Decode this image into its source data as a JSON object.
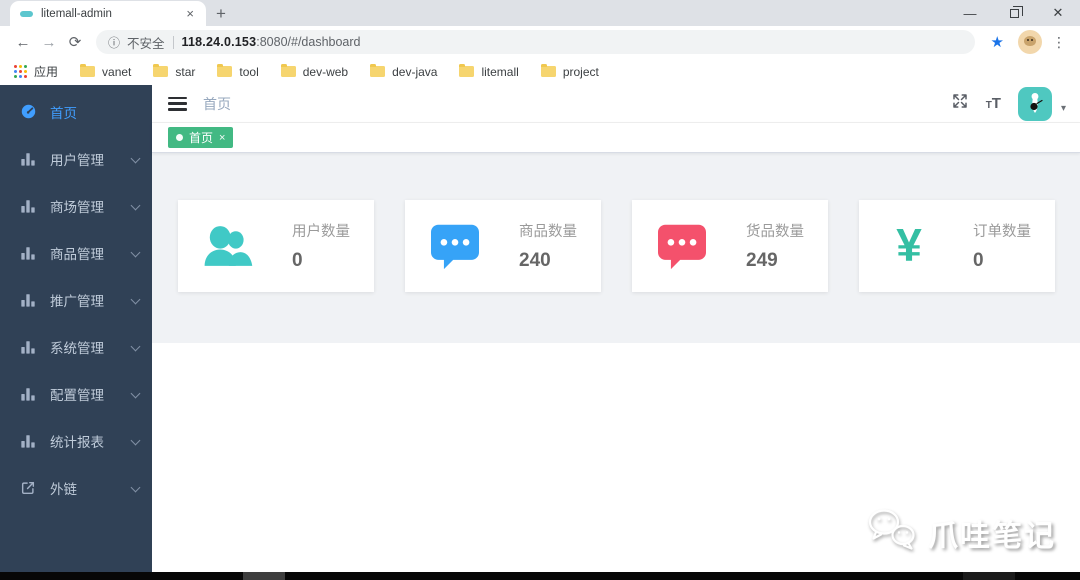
{
  "icons": {
    "back": "←",
    "forward": "→",
    "reload": "⟳",
    "info": "ⓘ",
    "star": "★",
    "menu_dots": "⋮",
    "new_tab": "+",
    "minimize": "—",
    "close_window": "✕",
    "tab_close": "×",
    "tag_close": "×",
    "caret_down": "▾",
    "yuan": "¥",
    "font_small": "T",
    "font_big": "T"
  },
  "browser": {
    "tab_title": "litemall-admin",
    "address": {
      "security_label": "不安全",
      "host": "118.24.0.153",
      "path": ":8080/#/dashboard"
    },
    "bookmarks": {
      "apps_label": "应用",
      "folders": [
        "vanet",
        "star",
        "tool",
        "dev-web",
        "dev-java",
        "litemall",
        "project"
      ]
    }
  },
  "sidebar": {
    "items": [
      {
        "label": "首页",
        "icon": "dashboard-icon",
        "active": true,
        "expandable": false
      },
      {
        "label": "用户管理",
        "icon": "bar-chart-icon",
        "active": false,
        "expandable": true
      },
      {
        "label": "商场管理",
        "icon": "bar-chart-icon",
        "active": false,
        "expandable": true
      },
      {
        "label": "商品管理",
        "icon": "bar-chart-icon",
        "active": false,
        "expandable": true
      },
      {
        "label": "推广管理",
        "icon": "bar-chart-icon",
        "active": false,
        "expandable": true
      },
      {
        "label": "系统管理",
        "icon": "bar-chart-icon",
        "active": false,
        "expandable": true
      },
      {
        "label": "配置管理",
        "icon": "bar-chart-icon",
        "active": false,
        "expandable": true
      },
      {
        "label": "统计报表",
        "icon": "bar-chart-icon",
        "active": false,
        "expandable": true
      },
      {
        "label": "外链",
        "icon": "external-link-icon",
        "active": false,
        "expandable": true
      }
    ]
  },
  "navbar": {
    "breadcrumb": "首页"
  },
  "tags": {
    "items": [
      {
        "label": "首页"
      }
    ]
  },
  "cards": {
    "items": [
      {
        "title": "用户数量",
        "value": "0",
        "icon": "users-icon",
        "color": "#40c9c6"
      },
      {
        "title": "商品数量",
        "value": "240",
        "icon": "message-icon",
        "color": "#36a3f7"
      },
      {
        "title": "货品数量",
        "value": "249",
        "icon": "message-icon",
        "color": "#f4516c"
      },
      {
        "title": "订单数量",
        "value": "0",
        "icon": "yuan-icon",
        "color": "#34bfa3"
      }
    ]
  },
  "watermark": {
    "text": "爪哇笔记"
  },
  "colors": {
    "sidebar_bg": "#304156",
    "sidebar_text": "#bfcbd9",
    "active_menu": "#409eff",
    "tag_green": "#42b983",
    "content_bg": "#f0f2f5"
  }
}
